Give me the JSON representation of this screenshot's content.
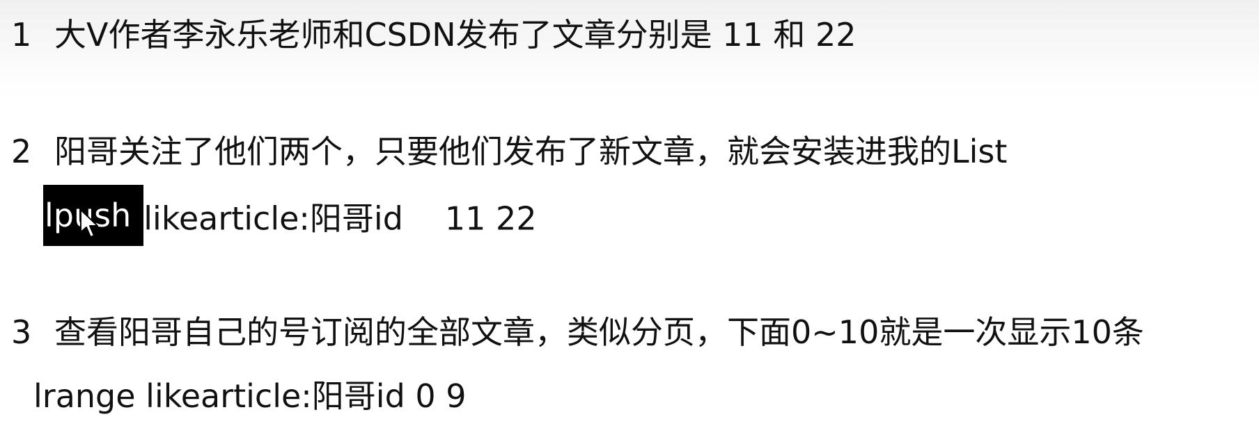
{
  "lines": [
    {
      "number": "1",
      "text": "大V作者李永乐老师和CSDN发布了文章分别是 11 和 22"
    },
    {
      "number": "2",
      "text": "阳哥关注了他们两个，只要他们发布了新文章，就会安装进我的List"
    },
    {
      "number": "3",
      "text": "查看阳哥自己的号订阅的全部文章，类似分页，下面0~10就是一次显示10条"
    }
  ],
  "commands": {
    "lpush": {
      "keyword": "lpush",
      "key": "likearticle:阳哥id",
      "values": "11 22"
    },
    "lrange": {
      "text": "lrange likearticle:阳哥id 0 9"
    }
  }
}
